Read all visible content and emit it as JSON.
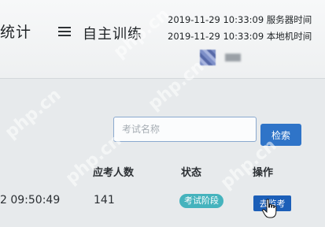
{
  "nav": {
    "left_label": "统计",
    "page_title": "自主训练",
    "menu_icon": "menu-icon"
  },
  "header": {
    "server_time": "2019-11-29 10:33:09 服务器时间",
    "local_time": "2019-11-29 10:33:09 本地机时间"
  },
  "search": {
    "placeholder": "考试名称",
    "button_label": "检索"
  },
  "table": {
    "columns": [
      "应考人数",
      "状态",
      "操作"
    ],
    "rows": [
      {
        "time": "2 09:50:49",
        "count": "141",
        "status": "考试阶段",
        "action": "去监考"
      }
    ]
  },
  "watermark": "php.cn",
  "colors": {
    "accent": "#2f74c8",
    "status_badge": "#45b3bd",
    "action_button": "#1c5fb8"
  }
}
